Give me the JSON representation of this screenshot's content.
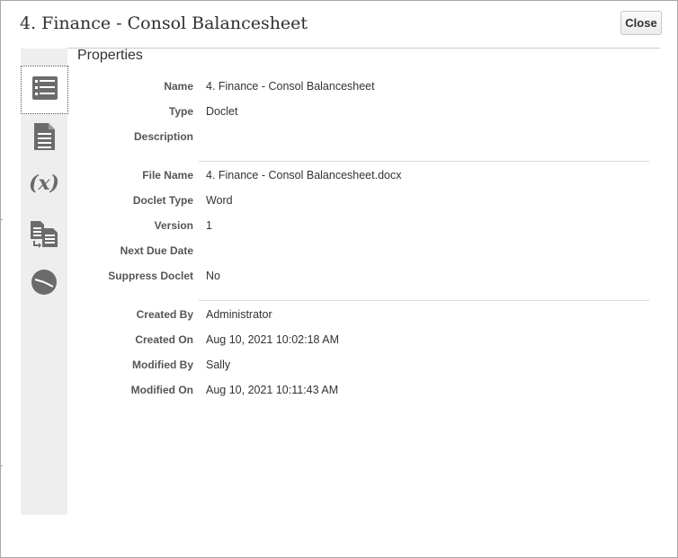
{
  "dialog": {
    "title": "4. Finance - Consol Balancesheet",
    "close_label": "Close"
  },
  "sidebar": {
    "tabs": [
      {
        "icon": "properties-list-icon",
        "active": true
      },
      {
        "icon": "document-icon",
        "active": false
      },
      {
        "icon": "variable-icon",
        "active": false
      },
      {
        "icon": "copy-transfer-icon",
        "active": false
      },
      {
        "icon": "clock-icon",
        "active": false
      }
    ]
  },
  "properties": {
    "section_title": "Properties",
    "general": [
      {
        "label": "Name",
        "value": "4. Finance - Consol Balancesheet"
      },
      {
        "label": "Type",
        "value": "Doclet"
      },
      {
        "label": "Description",
        "value": ""
      }
    ],
    "file": [
      {
        "label": "File Name",
        "value": "4. Finance - Consol Balancesheet.docx"
      },
      {
        "label": "Doclet Type",
        "value": "Word"
      },
      {
        "label": "Version",
        "value": "1"
      },
      {
        "label": "Next Due Date",
        "value": ""
      },
      {
        "label": "Suppress Doclet",
        "value": "No"
      }
    ],
    "audit": [
      {
        "label": "Created By",
        "value": "Administrator"
      },
      {
        "label": "Created On",
        "value": "Aug 10, 2021 10:02:18 AM"
      },
      {
        "label": "Modified By",
        "value": "Sally"
      },
      {
        "label": "Modified On",
        "value": "Aug 10, 2021 10:11:43 AM"
      }
    ]
  },
  "colors": {
    "rail_background": "#eeeeee",
    "icon_gray": "#6b6b6b"
  }
}
